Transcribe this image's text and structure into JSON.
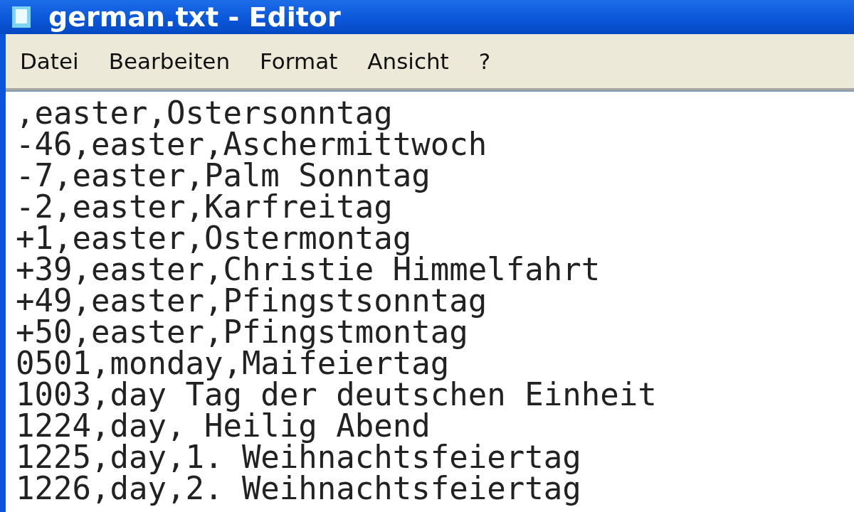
{
  "window": {
    "title": "german.txt - Editor"
  },
  "menu": [
    "Datei",
    "Bearbeiten",
    "Format",
    "Ansicht",
    "?"
  ],
  "lines": [
    ",easter,Ostersonntag",
    "-46,easter,Aschermittwoch",
    "-7,easter,Palm Sonntag",
    "-2,easter,Karfreitag",
    "+1,easter,Ostermontag",
    "+39,easter,Christie Himmelfahrt",
    "+49,easter,Pfingstsonntag",
    "+50,easter,Pfingstmontag",
    "0501,monday,Maifeiertag",
    "1003,day Tag der deutschen Einheit",
    "1224,day, Heilig Abend",
    "1225,day,1. Weihnachtsfeiertag",
    "1226,day,2. Weihnachtsfeiertag"
  ]
}
